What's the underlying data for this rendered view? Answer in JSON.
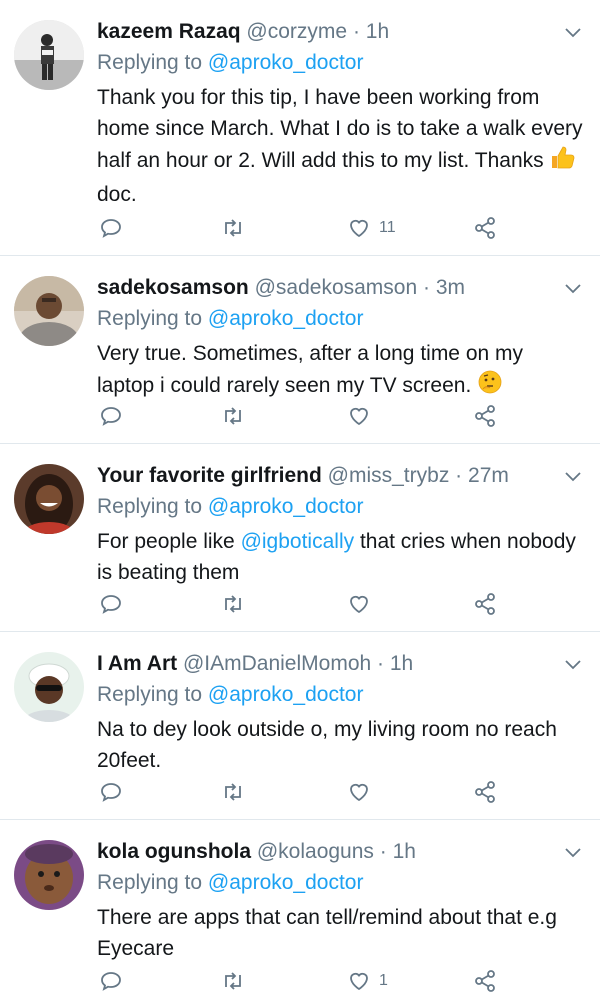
{
  "tweets": [
    {
      "name": "kazeem Razaq",
      "handle": "@corzyme",
      "dot": "·",
      "time": "1h",
      "replying_prefix": "Replying to",
      "replying_to": "@aproko_doctor",
      "body_parts": [
        "Thank you for this tip, I have been working from home since March. What  I do is to take a walk every half an hour or 2. Will add this to my list. Thanks ",
        " doc."
      ],
      "emoji": "thumbs-up-emoji",
      "likes": "11"
    },
    {
      "name": "sadekosamson",
      "handle": "@sadekosamson",
      "dot": "·",
      "time": "3m",
      "replying_prefix": "Replying to",
      "replying_to": "@aproko_doctor",
      "body_parts": [
        "Very true.  Sometimes, after a long time on my laptop i could rarely seen my TV screen. ",
        ""
      ],
      "emoji": "thinking-face-emoji",
      "likes": ""
    },
    {
      "name": "Your favorite girlfriend",
      "handle": "@miss_trybz",
      "dot": "·",
      "time": "27m",
      "replying_prefix": "Replying to",
      "replying_to": "@aproko_doctor",
      "body_pre": "For people like ",
      "body_mention": "@igbotically",
      "body_post": " that cries when nobody is beating them",
      "likes": ""
    },
    {
      "name": "I Am Art",
      "handle": "@IAmDanielMomoh",
      "dot": "·",
      "time": "1h",
      "replying_prefix": "Replying to",
      "replying_to": "@aproko_doctor",
      "body": "Na to dey look outside o, my living room no reach 20feet.",
      "likes": ""
    },
    {
      "name": "kola ogunshola",
      "handle": "@kolaoguns",
      "dot": "·",
      "time": "1h",
      "replying_prefix": "Replying to",
      "replying_to": "@aproko_doctor",
      "body": "There are apps that can tell/remind about that e.g Eyecare",
      "likes": "1"
    }
  ],
  "icons": {
    "reply": "reply-icon",
    "retweet": "retweet-icon",
    "like": "heart-icon",
    "share": "share-icon",
    "more": "chevron-down-icon"
  },
  "colors": {
    "link": "#1da1f2",
    "muted": "#657786",
    "text": "#14171a",
    "divider": "#e1e8ed"
  }
}
